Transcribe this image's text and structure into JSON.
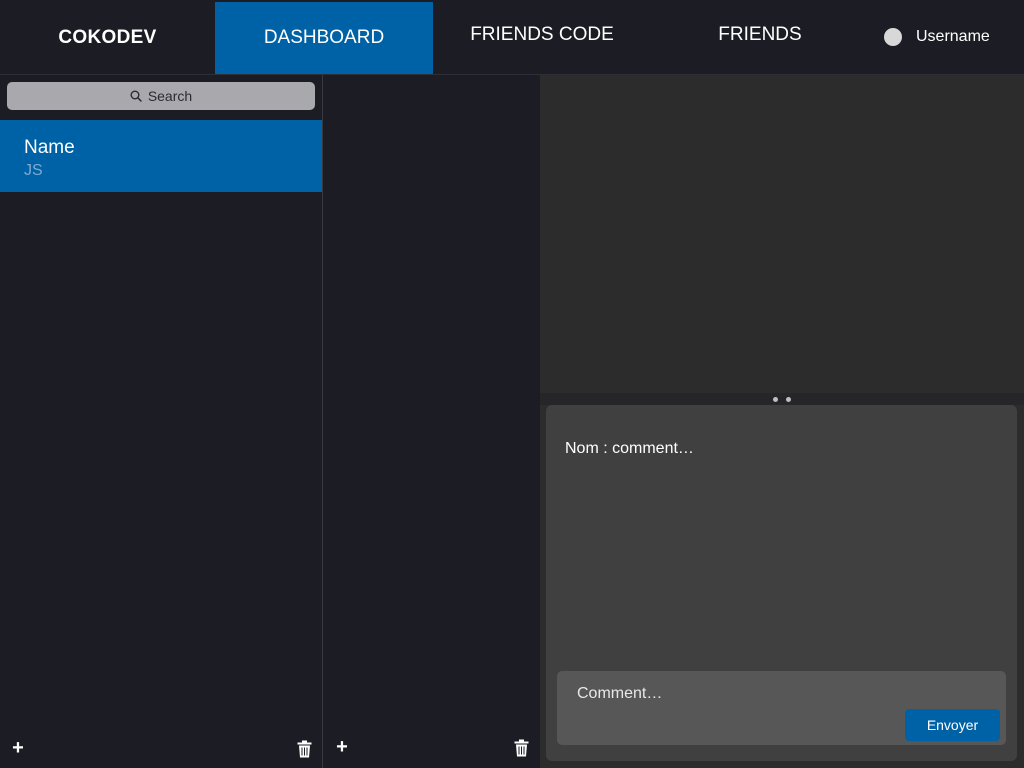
{
  "header": {
    "brand": "COKODEV",
    "tabs": [
      {
        "label": "DASHBOARD",
        "active": true
      },
      {
        "label": "FRIENDS CODE",
        "active": false
      },
      {
        "label": "FRIENDS",
        "active": false
      }
    ],
    "username": "Username"
  },
  "projects": {
    "search_label": "Search",
    "items": [
      {
        "name": "Name",
        "language": "JS",
        "selected": true
      }
    ],
    "add_label": "+"
  },
  "files": {
    "add_label": "+"
  },
  "comments": {
    "items": [
      {
        "text": "Nom : comment…"
      }
    ],
    "input_placeholder": "Comment…",
    "send_label": "Envoyer"
  },
  "colors": {
    "background": "#1c1c24",
    "accent": "#0062a6",
    "panel": "#404040",
    "editor": "#2c2c2c"
  }
}
